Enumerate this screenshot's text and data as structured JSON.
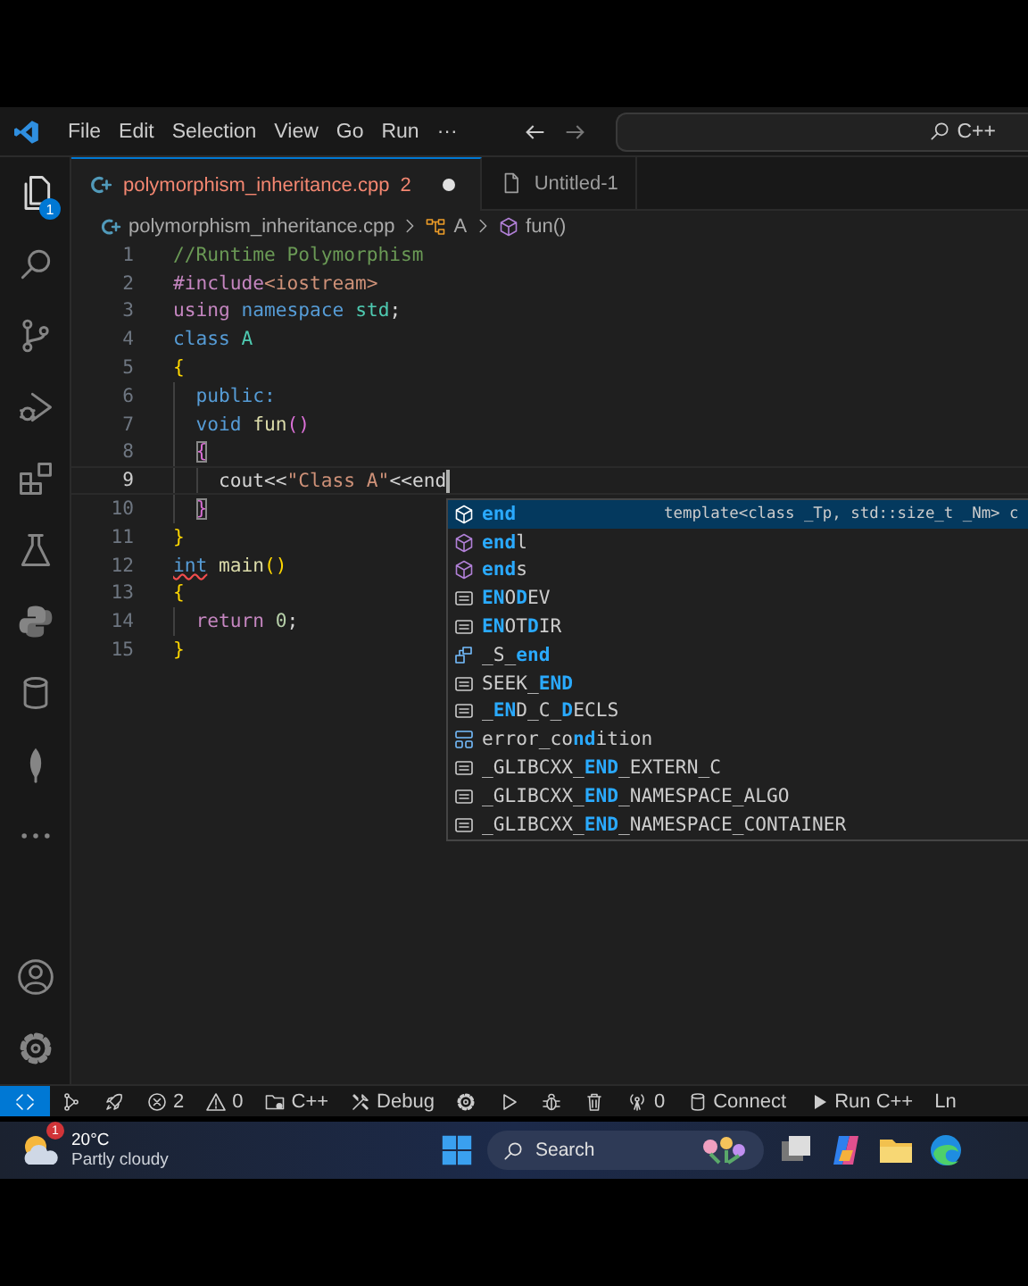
{
  "titlebar": {
    "menu": [
      "File",
      "Edit",
      "Selection",
      "View",
      "Go",
      "Run",
      "···"
    ],
    "command_center": "C++"
  },
  "activity_bar": {
    "items": [
      {
        "kind": "files",
        "selected": true,
        "badge": "1"
      },
      {
        "kind": "search",
        "selected": false
      },
      {
        "kind": "branch",
        "selected": false
      },
      {
        "kind": "debug",
        "selected": false
      },
      {
        "kind": "extensions",
        "selected": false
      },
      {
        "kind": "flask",
        "selected": false
      },
      {
        "kind": "python",
        "selected": false
      },
      {
        "kind": "database",
        "selected": false
      },
      {
        "kind": "leaf",
        "selected": false
      },
      {
        "kind": "more",
        "selected": false
      }
    ],
    "bottom": [
      {
        "kind": "account"
      },
      {
        "kind": "gear"
      }
    ]
  },
  "tabs": [
    {
      "kind": "cpp",
      "label": "polymorphism_inheritance.cpp",
      "problems": "2",
      "modified": true,
      "selected": true
    },
    {
      "kind": "file",
      "label": "Untitled-1",
      "selected": false
    }
  ],
  "breadcrumbs": [
    {
      "kind": "cpp",
      "label": "polymorphism_inheritance.cpp"
    },
    {
      "kind": "class",
      "label": "A"
    },
    {
      "kind": "method",
      "label": "fun()"
    }
  ],
  "editor": {
    "lines": [
      {
        "number": "1",
        "tokens": [
          {
            "kind": "comment",
            "text": "//Runtime Polymorphism"
          }
        ]
      },
      {
        "number": "2",
        "tokens": [
          {
            "kind": "control",
            "text": "#include"
          },
          {
            "kind": "string",
            "text": "<iostream>"
          }
        ]
      },
      {
        "number": "3",
        "tokens": [
          {
            "kind": "control",
            "text": "using "
          },
          {
            "kind": "keyword",
            "text": "namespace "
          },
          {
            "kind": "type",
            "text": "std"
          },
          {
            "kind": "plain",
            "text": ";"
          }
        ]
      },
      {
        "number": "4",
        "tokens": [
          {
            "kind": "keyword",
            "text": "class "
          },
          {
            "kind": "type",
            "text": "A"
          }
        ]
      },
      {
        "number": "5",
        "tokens": [
          {
            "kind": "brace",
            "text": "{"
          }
        ]
      },
      {
        "number": "6",
        "tokens": [
          {
            "kind": "keyword",
            "text": "  public:"
          }
        ]
      },
      {
        "number": "7",
        "tokens": [
          {
            "kind": "keyword",
            "text": "  void "
          },
          {
            "kind": "func",
            "text": "fun"
          },
          {
            "kind": "paren",
            "text": "()"
          }
        ]
      },
      {
        "number": "8",
        "tokens": [
          {
            "kind": "paren",
            "text": "  {",
            "matched": true
          }
        ]
      },
      {
        "number": "9",
        "current": true,
        "tokens": [
          {
            "kind": "plain",
            "text": "    cout<<"
          },
          {
            "kind": "string",
            "text": "\"Class A\""
          },
          {
            "kind": "plain",
            "text": "<<end"
          }
        ]
      },
      {
        "number": "10",
        "tokens": [
          {
            "kind": "paren",
            "text": "  }",
            "matched": true
          }
        ]
      },
      {
        "number": "11",
        "tokens": [
          {
            "kind": "brace",
            "text": "}"
          }
        ]
      },
      {
        "number": "12",
        "tokens": [
          {
            "kind": "keyword",
            "text": "int",
            "error": true
          },
          {
            "kind": "func",
            "text": " main"
          },
          {
            "kind": "brace",
            "text": "()"
          }
        ]
      },
      {
        "number": "13",
        "tokens": [
          {
            "kind": "brace",
            "text": "{"
          }
        ]
      },
      {
        "number": "14",
        "tokens": [
          {
            "kind": "control",
            "text": "  return "
          },
          {
            "kind": "number",
            "text": "0"
          },
          {
            "kind": "plain",
            "text": ";"
          }
        ]
      },
      {
        "number": "15",
        "tokens": [
          {
            "kind": "brace",
            "text": "}"
          }
        ]
      }
    ]
  },
  "suggestions": {
    "items": [
      {
        "kind": "method",
        "selected": true,
        "parts": [
          {
            "text": "end",
            "match": true
          }
        ],
        "detail": "template<class _Tp, std::size_t _Nm> c"
      },
      {
        "kind": "method",
        "selected": false,
        "parts": [
          {
            "text": "end",
            "match": true
          },
          {
            "text": "l",
            "match": false
          }
        ]
      },
      {
        "kind": "method",
        "selected": false,
        "parts": [
          {
            "text": "end",
            "match": true
          },
          {
            "text": "s",
            "match": false
          }
        ]
      },
      {
        "kind": "constant",
        "selected": false,
        "parts": [
          {
            "text": "EN",
            "match": true
          },
          {
            "text": "O",
            "match": false
          },
          {
            "text": "D",
            "match": true
          },
          {
            "text": "EV",
            "match": false
          }
        ]
      },
      {
        "kind": "constant",
        "selected": false,
        "parts": [
          {
            "text": "EN",
            "match": true
          },
          {
            "text": "OT",
            "match": false
          },
          {
            "text": "D",
            "match": true
          },
          {
            "text": "IR",
            "match": false
          }
        ]
      },
      {
        "kind": "struct",
        "selected": false,
        "parts": [
          {
            "text": "_S_",
            "match": false
          },
          {
            "text": "end",
            "match": true
          }
        ]
      },
      {
        "kind": "constant",
        "selected": false,
        "parts": [
          {
            "text": "SEEK_",
            "match": false
          },
          {
            "text": "END",
            "match": true
          }
        ]
      },
      {
        "kind": "constant",
        "selected": false,
        "parts": [
          {
            "text": "_",
            "match": false
          },
          {
            "text": "EN",
            "match": true
          },
          {
            "text": "D_C_",
            "match": false
          },
          {
            "text": "D",
            "match": true
          },
          {
            "text": "ECLS",
            "match": false
          }
        ]
      },
      {
        "kind": "class",
        "selected": false,
        "parts": [
          {
            "text": "error_co",
            "match": false
          },
          {
            "text": "nd",
            "match": true
          },
          {
            "text": "ition",
            "match": false
          }
        ]
      },
      {
        "kind": "constant",
        "selected": false,
        "parts": [
          {
            "text": "_GLIBCXX_",
            "match": false
          },
          {
            "text": "END",
            "match": true
          },
          {
            "text": "_EXTERN_C",
            "match": false
          }
        ]
      },
      {
        "kind": "constant",
        "selected": false,
        "parts": [
          {
            "text": "_GLIBCXX_",
            "match": false
          },
          {
            "text": "END",
            "match": true
          },
          {
            "text": "_NAMESPACE_ALGO",
            "match": false
          }
        ]
      },
      {
        "kind": "constant",
        "selected": false,
        "parts": [
          {
            "text": "_GLIBCXX_",
            "match": false
          },
          {
            "text": "END",
            "match": true
          },
          {
            "text": "_NAMESPACE_CONTAINER",
            "match": false
          }
        ]
      }
    ]
  },
  "status_bar": [
    {
      "kind": "remote"
    },
    {
      "kind": "graph"
    },
    {
      "kind": "rocket"
    },
    {
      "kind": "errors",
      "text": "2"
    },
    {
      "kind": "warnings",
      "text": "0"
    },
    {
      "kind": "folder",
      "text": "C++"
    },
    {
      "kind": "tools",
      "text": "Debug"
    },
    {
      "kind": "gear"
    },
    {
      "kind": "play"
    },
    {
      "kind": "bug"
    },
    {
      "kind": "trash"
    },
    {
      "kind": "antenna",
      "text": "0"
    },
    {
      "kind": "database",
      "text": "Connect"
    },
    {
      "kind": "run",
      "text": "Run C++"
    },
    {
      "kind": "plain",
      "text": "Ln"
    }
  ],
  "taskbar": {
    "weather": {
      "badge": "1",
      "temperature": "20°C",
      "condition": "Partly cloudy"
    },
    "items": [
      {
        "kind": "start"
      },
      {
        "kind": "search",
        "placeholder": "Search"
      },
      {
        "kind": "taskview"
      },
      {
        "kind": "copilot"
      },
      {
        "kind": "explorer"
      },
      {
        "kind": "edge"
      }
    ]
  }
}
